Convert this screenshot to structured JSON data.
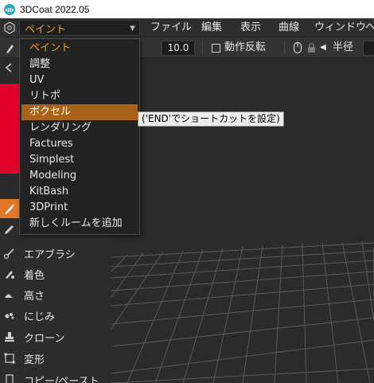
{
  "window": {
    "title": "3DCoat 2022.05"
  },
  "menubar": {
    "room_selected": "ペイント",
    "items": [
      "ファイル",
      "編集",
      "表示",
      "曲線",
      "ウィンドウ"
    ]
  },
  "toolbar": {
    "value_field": "10.0",
    "mirror_label": "動作反転",
    "radius_label": "半径"
  },
  "room_dropdown": {
    "items": [
      "ペイント",
      "調整",
      "UV",
      "リトポ",
      "ボクセル",
      "レンダリング",
      "Factures",
      "Simplest",
      "Modeling",
      "KitBash",
      "3DPrint",
      "新しくルームを追加"
    ],
    "selected_index": 0,
    "hovered_index": 4
  },
  "tooltip": {
    "text": "('END'でショートカットを設定)"
  },
  "tools": [
    {
      "label": "エアブラシ",
      "icon": "airbrush-icon"
    },
    {
      "label": "着色",
      "icon": "paint-color-icon"
    },
    {
      "label": "高さ",
      "icon": "height-icon"
    },
    {
      "label": "にじみ",
      "icon": "smudge-icon"
    },
    {
      "label": "クローン",
      "icon": "clone-stamp-icon"
    },
    {
      "label": "変形",
      "icon": "transform-icon"
    },
    {
      "label": "コピー/ペースト",
      "icon": "copy-paste-icon"
    }
  ],
  "colors": {
    "accent_orange": "#e0782a",
    "hover_orange": "#a8621a",
    "selected_text": "#f0a030",
    "primary_color_swatch": "#e0002a"
  }
}
